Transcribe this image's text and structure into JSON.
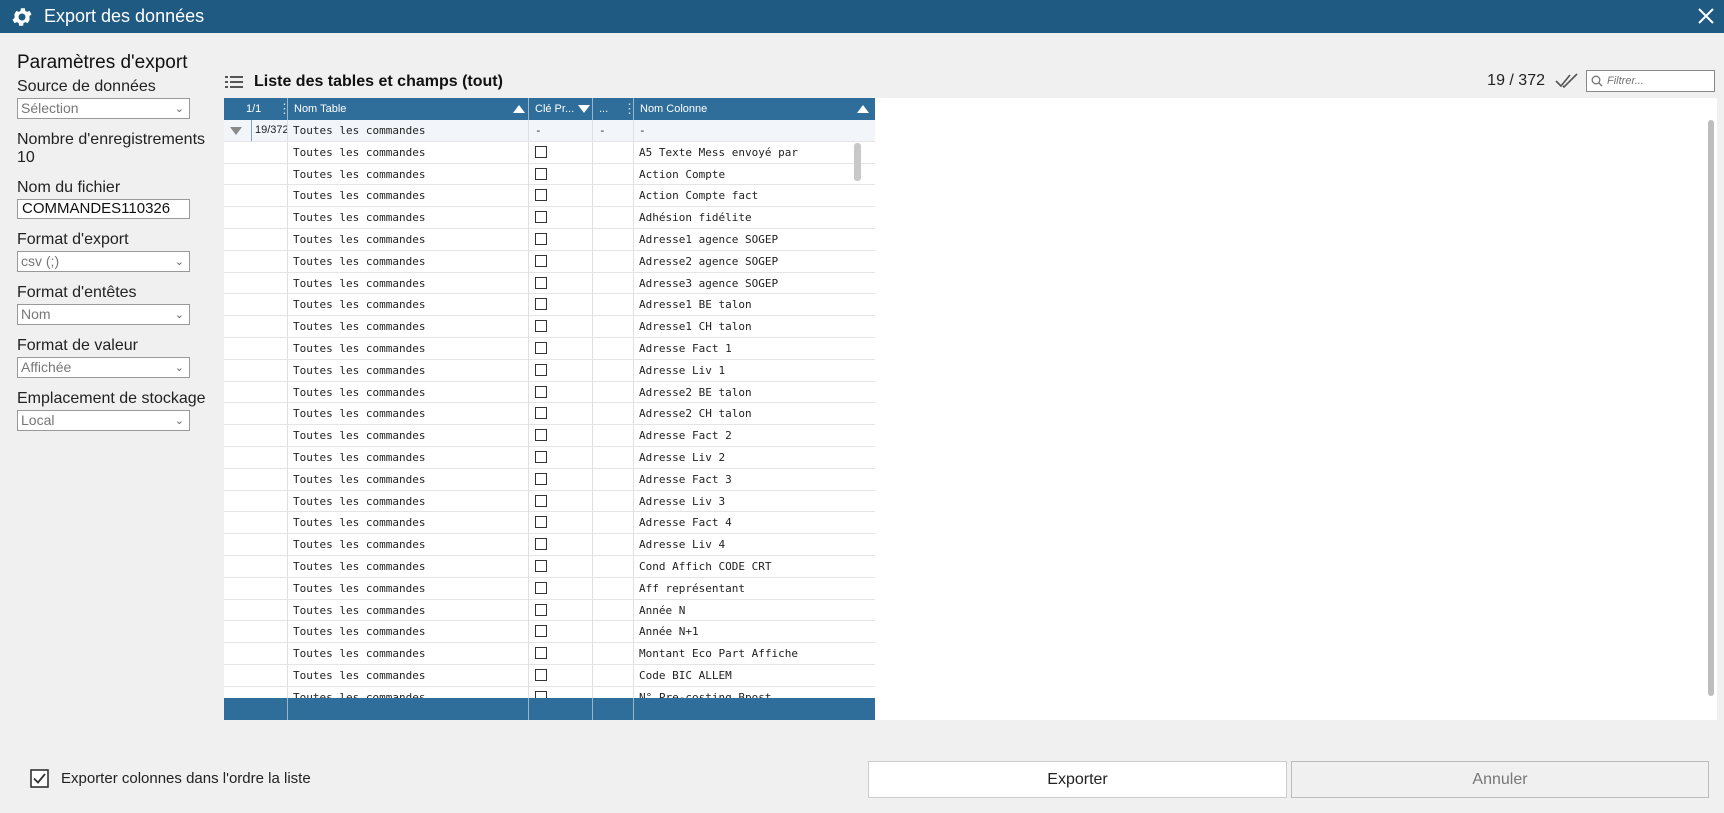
{
  "window": {
    "title": "Export des données"
  },
  "params": {
    "heading": "Paramètres d'export",
    "source": {
      "label": "Source de données",
      "value": "Sélection"
    },
    "records": {
      "label": "Nombre d'enregistrements",
      "value": "10"
    },
    "filename": {
      "label": "Nom du fichier",
      "value": "COMMANDES110326"
    },
    "format": {
      "label": "Format d'export",
      "value": "csv (;)"
    },
    "headers": {
      "label": "Format d'entêtes",
      "value": "Nom"
    },
    "valueformat": {
      "label": "Format de valeur",
      "value": "Affichée"
    },
    "storage": {
      "label": "Emplacement de stockage",
      "value": "Local"
    }
  },
  "list": {
    "title": "Liste des tables et champs (tout)",
    "count": "19 / 372",
    "filter_placeholder": "Filtrer..."
  },
  "grid": {
    "columns": {
      "page": "1/1",
      "table": "Nom Table",
      "key": "Clé Pr...",
      "extra": "...",
      "column": "Nom Colonne"
    },
    "group": {
      "count": "19/372",
      "table": "Toutes les commandes",
      "key": "-",
      "extra": "-",
      "column": "-"
    },
    "rows": [
      {
        "table": "Toutes les commandes",
        "column": "A5 Texte Mess envoyé par"
      },
      {
        "table": "Toutes les commandes",
        "column": "Action Compte"
      },
      {
        "table": "Toutes les commandes",
        "column": "Action Compte fact"
      },
      {
        "table": "Toutes les commandes",
        "column": "Adhésion fidélite"
      },
      {
        "table": "Toutes les commandes",
        "column": "Adresse1 agence SOGEP"
      },
      {
        "table": "Toutes les commandes",
        "column": "Adresse2 agence SOGEP"
      },
      {
        "table": "Toutes les commandes",
        "column": "Adresse3 agence SOGEP"
      },
      {
        "table": "Toutes les commandes",
        "column": "Adresse1 BE talon"
      },
      {
        "table": "Toutes les commandes",
        "column": "Adresse1 CH talon"
      },
      {
        "table": "Toutes les commandes",
        "column": "Adresse Fact 1"
      },
      {
        "table": "Toutes les commandes",
        "column": "Adresse Liv 1"
      },
      {
        "table": "Toutes les commandes",
        "column": "Adresse2 BE talon"
      },
      {
        "table": "Toutes les commandes",
        "column": "Adresse2 CH talon"
      },
      {
        "table": "Toutes les commandes",
        "column": "Adresse Fact 2"
      },
      {
        "table": "Toutes les commandes",
        "column": "Adresse Liv 2"
      },
      {
        "table": "Toutes les commandes",
        "column": "Adresse Fact 3"
      },
      {
        "table": "Toutes les commandes",
        "column": "Adresse Liv 3"
      },
      {
        "table": "Toutes les commandes",
        "column": "Adresse Fact 4"
      },
      {
        "table": "Toutes les commandes",
        "column": "Adresse Liv 4"
      },
      {
        "table": "Toutes les commandes",
        "column": "Cond Affich CODE CRT"
      },
      {
        "table": "Toutes les commandes",
        "column": "Aff représentant"
      },
      {
        "table": "Toutes les commandes",
        "column": "Année N"
      },
      {
        "table": "Toutes les commandes",
        "column": "Année N+1"
      },
      {
        "table": "Toutes les commandes",
        "column": "Montant Eco Part Affiche"
      },
      {
        "table": "Toutes les commandes",
        "column": "Code BIC ALLEM"
      },
      {
        "table": "Toutes les commandes",
        "column": "N° Pre-costing Bpost"
      }
    ]
  },
  "footer": {
    "order_check_label": "Exporter colonnes dans l'ordre la liste",
    "export_label": "Exporter",
    "cancel_label": "Annuler"
  },
  "colors": {
    "titlebar": "#1f5a83",
    "grid_header": "#2f6e9b",
    "background": "#f0f0f0"
  }
}
